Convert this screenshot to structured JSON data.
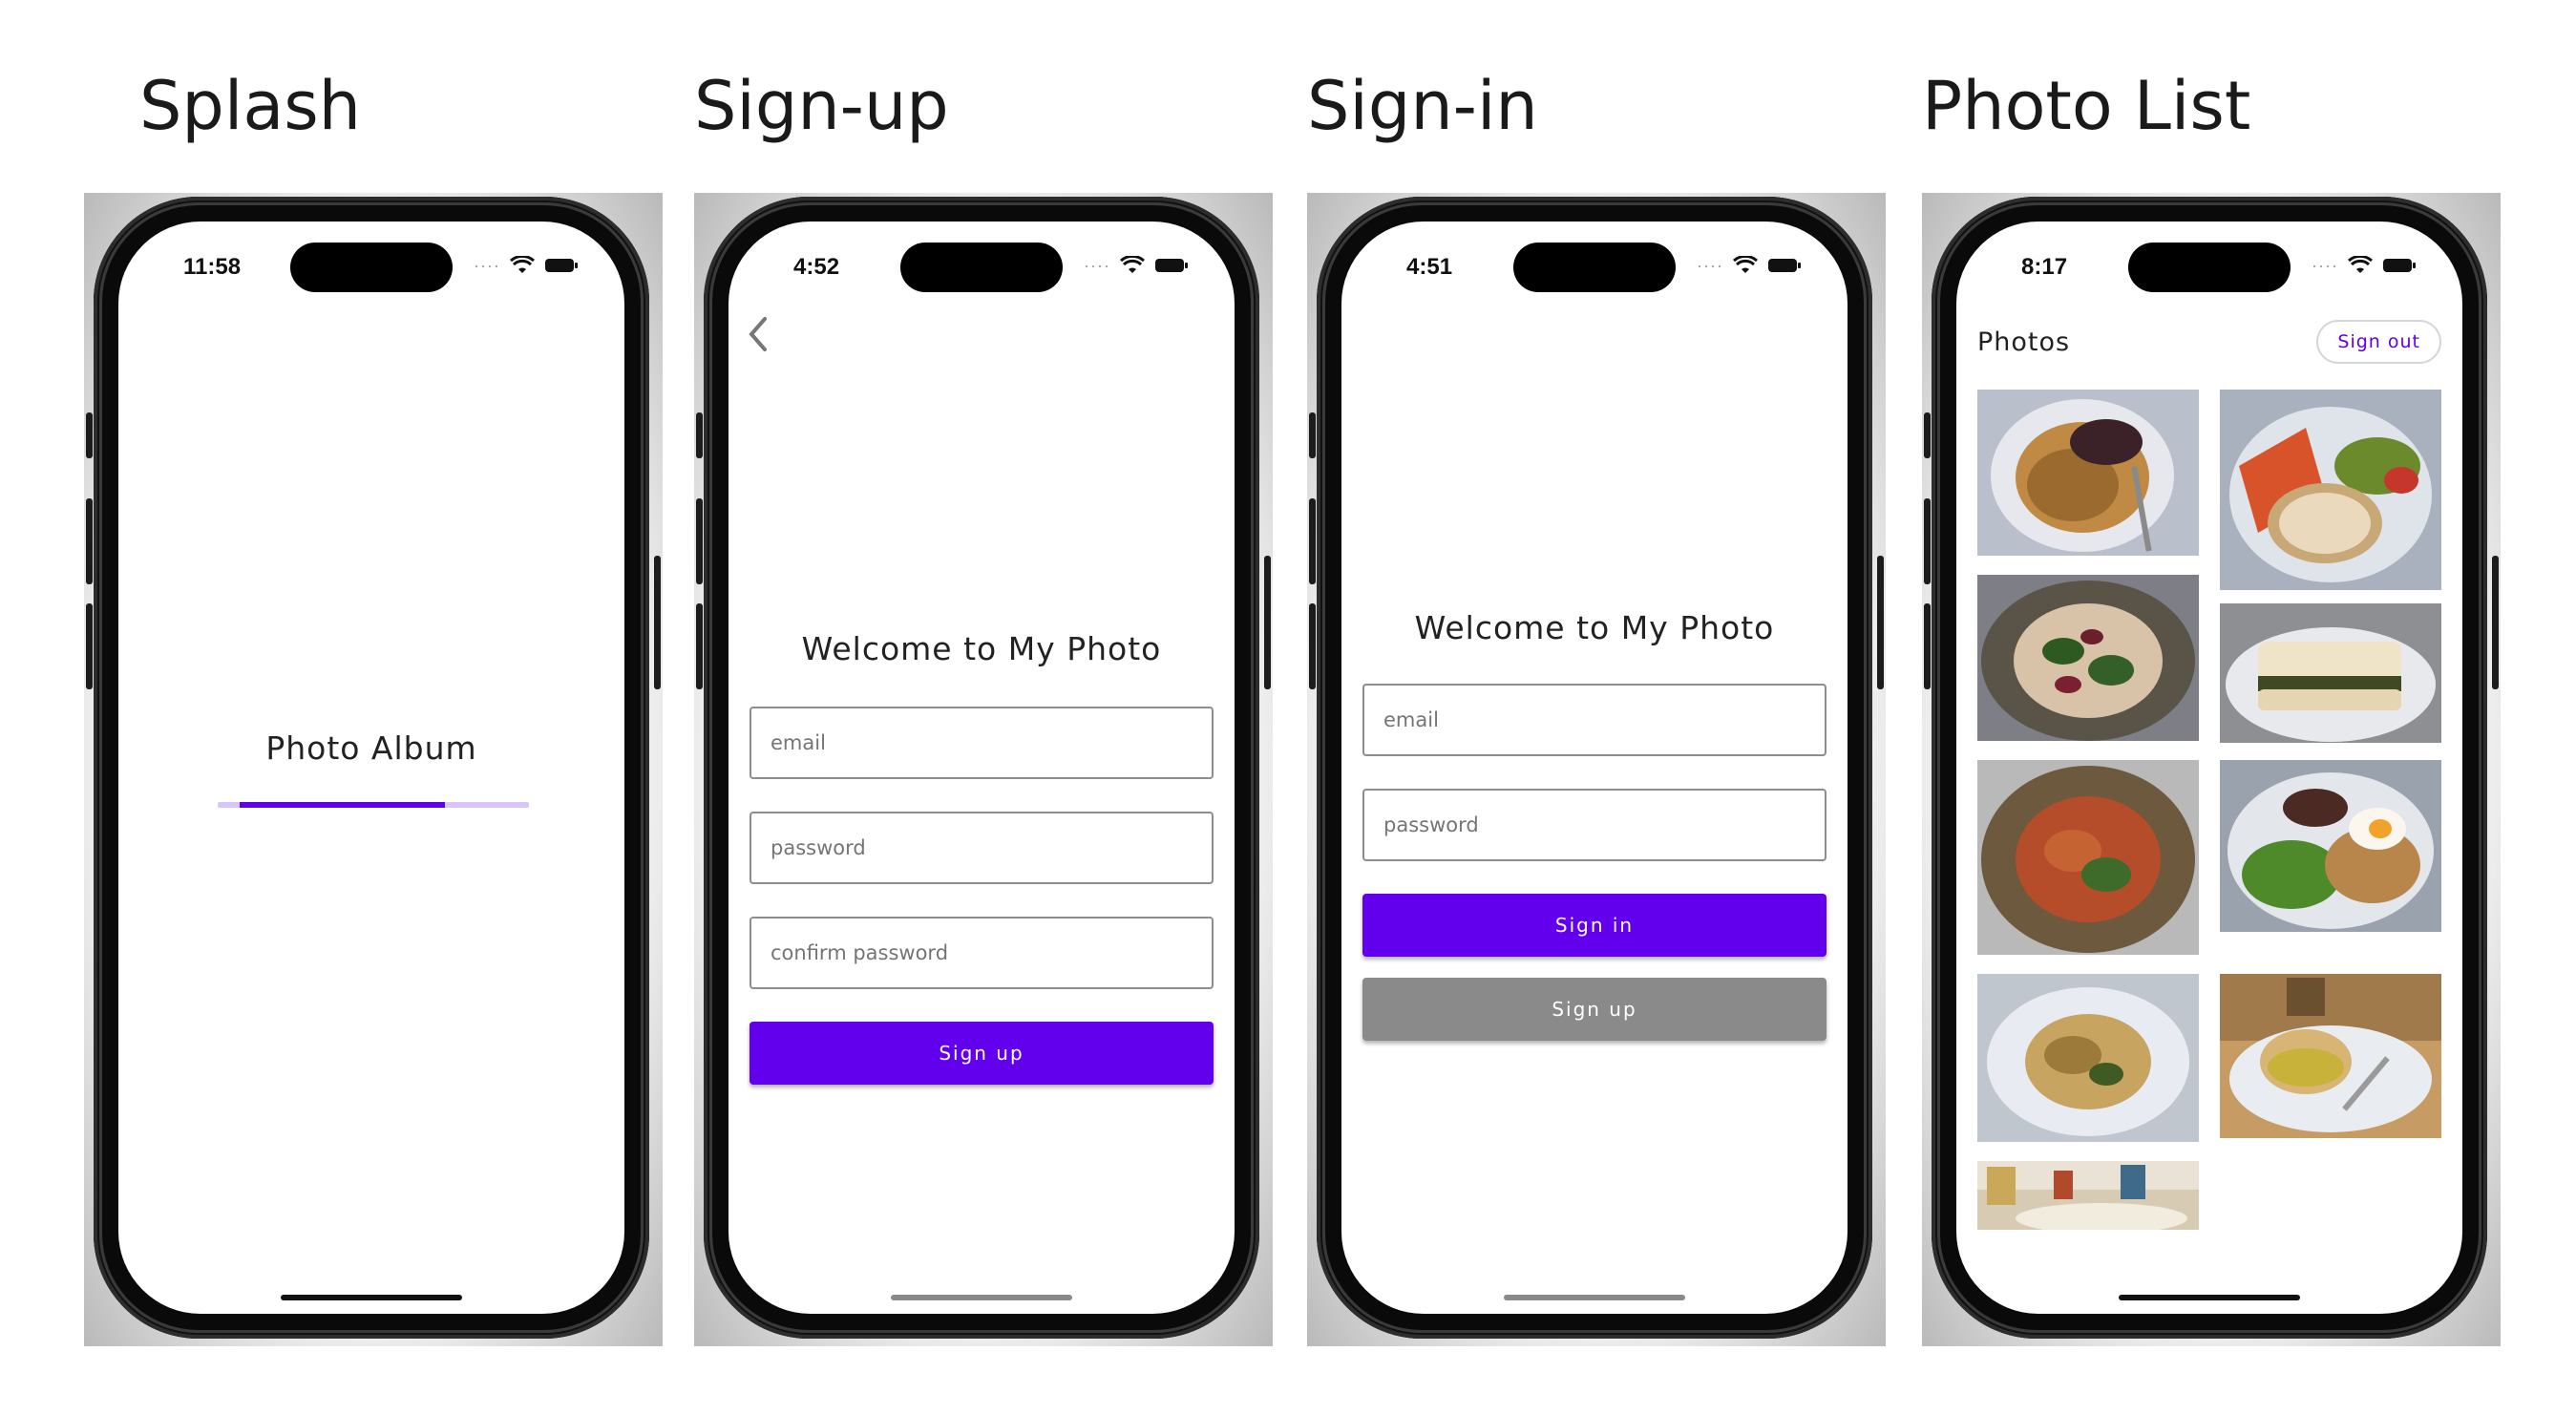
{
  "screens": [
    {
      "key": "splash",
      "title": "Splash"
    },
    {
      "key": "signup",
      "title": "Sign-up"
    },
    {
      "key": "signin",
      "title": "Sign-in"
    },
    {
      "key": "photolist",
      "title": "Photo List"
    }
  ],
  "splash": {
    "time": "11:58",
    "app_name": "Photo Album",
    "progress_fraction_start": 0.07,
    "progress_fraction_end": 0.73
  },
  "signup": {
    "time": "4:52",
    "welcome": "Welcome to My Photo",
    "email_placeholder": "email",
    "password_placeholder": "password",
    "confirm_placeholder": "confirm password",
    "signup_label": "Sign up"
  },
  "signin": {
    "time": "4:51",
    "welcome": "Welcome to My Photo",
    "email_placeholder": "email",
    "password_placeholder": "password",
    "signin_label": "Sign in",
    "signup_label": "Sign up"
  },
  "photolist": {
    "time": "8:17",
    "title": "Photos",
    "signout_label": "Sign out"
  },
  "colors": {
    "primary": "#6200ee",
    "secondary_button": "#8a8a8a",
    "progress_track": "#d8c6fb"
  }
}
